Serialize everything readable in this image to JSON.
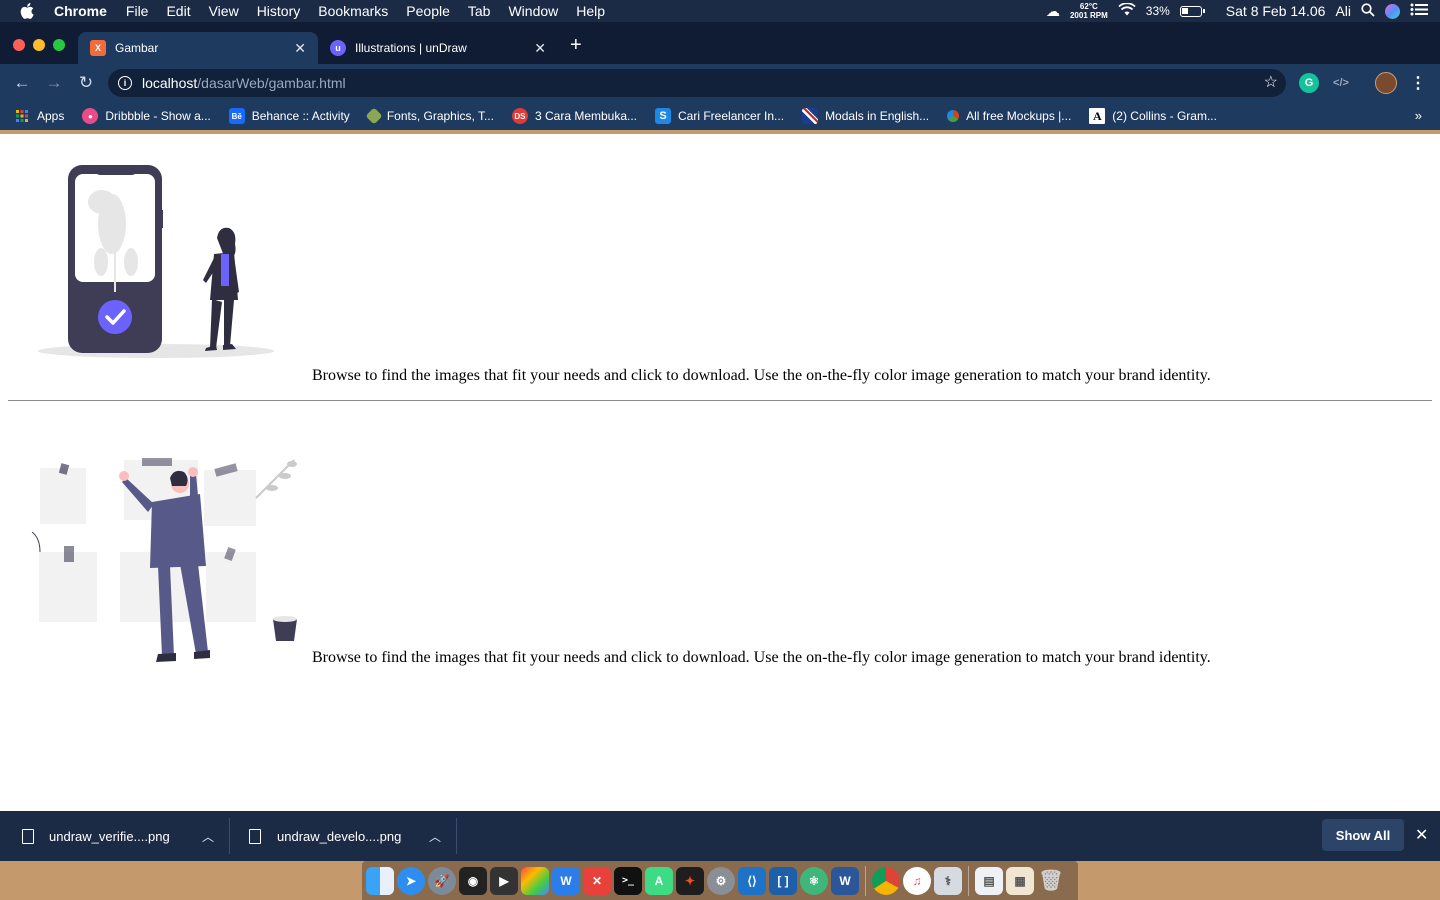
{
  "menubar": {
    "app": "Chrome",
    "items": [
      "File",
      "Edit",
      "View",
      "History",
      "Bookmarks",
      "People",
      "Tab",
      "Window",
      "Help"
    ],
    "temp": "62°C",
    "rpm": "2001 RPM",
    "battery": "33%",
    "battery_level": 0.33,
    "clock": "Sat 8 Feb  14.06",
    "user": "Ali"
  },
  "tabs": [
    {
      "title": "Gambar",
      "favicon": "xampp-icon",
      "color": "#f26b3a"
    },
    {
      "title": "Illustrations | unDraw",
      "favicon": "undraw-icon",
      "color": "#6c63ff"
    }
  ],
  "address": {
    "host": "localhost",
    "path": "/dasarWeb/gambar.html"
  },
  "bookmarks": [
    {
      "label": "Apps",
      "icon": "apps-grid-icon",
      "color": "#4285f4"
    },
    {
      "label": "Dribbble - Show a...",
      "icon": "dribbble-icon",
      "color": "#ea4c89"
    },
    {
      "label": "Behance :: Activity",
      "icon": "behance-icon",
      "color": "#1769ff"
    },
    {
      "label": "Fonts, Graphics, T...",
      "icon": "creative-market-icon",
      "color": "#8ba753"
    },
    {
      "label": "3 Cara Membuka...",
      "icon": "ds-icon",
      "color": "#e53935"
    },
    {
      "label": "Cari Freelancer In...",
      "icon": "sribulancer-icon",
      "color": "#1e88e5"
    },
    {
      "label": "Modals in English...",
      "icon": "uk-flag-icon",
      "color": "#c62828"
    },
    {
      "label": "All free Mockups |...",
      "icon": "mockups-icon",
      "color": "#d84315"
    },
    {
      "label": "(2) Collins - Gram...",
      "icon": "collins-icon",
      "color": "#ffffff"
    }
  ],
  "content": {
    "caption_1": "Browse to find the images that fit your needs and click to download. Use the on-the-fly color image generation to match your brand identity.",
    "caption_2": "Browse to find the images that fit your needs and click to download. Use the on-the-fly color image generation to match your brand identity.",
    "accent": "#6c63ff",
    "figure_color": "#3f3d56"
  },
  "downloads": {
    "items": [
      {
        "name": "undraw_verifie....png"
      },
      {
        "name": "undraw_develo....png"
      }
    ],
    "show_all": "Show All"
  },
  "dock": [
    "finder",
    "safari",
    "launchpad",
    "photo-booth",
    "final-cut",
    "rainbow",
    "wps",
    "xmind",
    "terminal",
    "android-studio",
    "figma",
    "system-preferences",
    "vscode",
    "brackets",
    "atom",
    "word",
    "chrome",
    "music",
    "disk-utility",
    "documents",
    "downloads-stack",
    "trash"
  ]
}
